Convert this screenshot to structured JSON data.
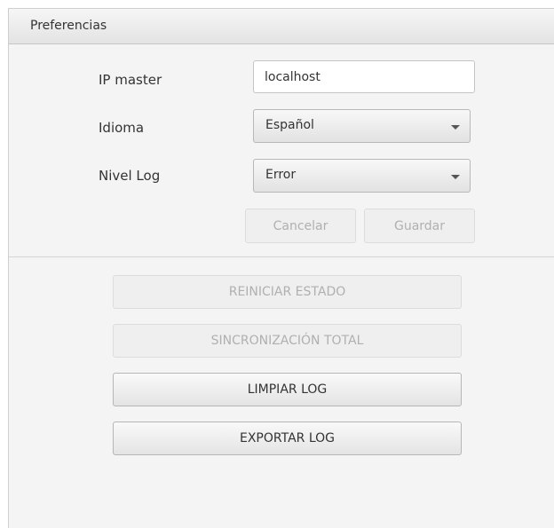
{
  "panel": {
    "title": "Preferencias"
  },
  "form": {
    "ip_label": "IP master",
    "ip_value": "localhost",
    "language_label": "Idioma",
    "language_value": "Español",
    "log_level_label": "Nivel Log",
    "log_level_value": "Error"
  },
  "form_buttons": {
    "cancel": "Cancelar",
    "save": "Guardar"
  },
  "actions": {
    "reset_state": "REINICIAR ESTADO",
    "full_sync": "SINCRONIZACIÓN TOTAL",
    "clear_log": "LIMPIAR LOG",
    "export_log": "EXPORTAR LOG"
  },
  "icons": {
    "dropdown": "chevron-down-icon"
  }
}
